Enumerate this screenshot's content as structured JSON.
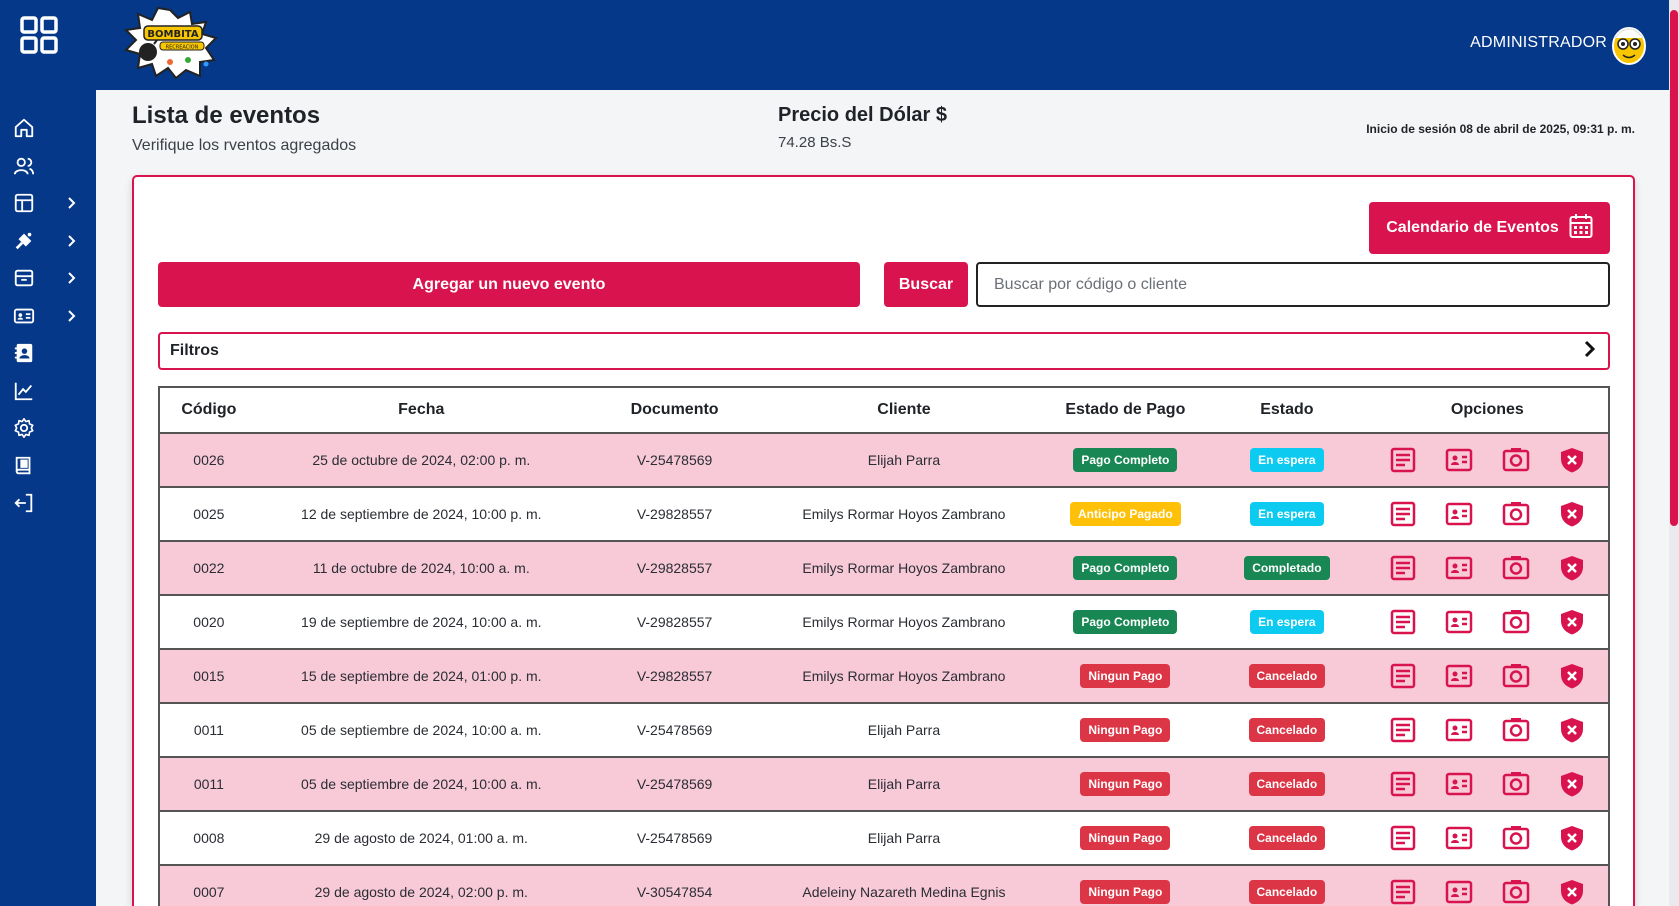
{
  "header": {
    "brand_text": "BOMBITA RECREACION",
    "admin_label": "ADMINISTRADOR"
  },
  "sidebar": {
    "items": [
      {
        "name": "home-icon",
        "chevron": false
      },
      {
        "name": "users-icon",
        "chevron": false
      },
      {
        "name": "layout-icon",
        "chevron": true
      },
      {
        "name": "palette-icon",
        "chevron": true
      },
      {
        "name": "archive-icon",
        "chevron": true
      },
      {
        "name": "id-card-icon",
        "chevron": true
      },
      {
        "name": "contact-icon",
        "chevron": false
      },
      {
        "name": "chart-icon",
        "chevron": false
      },
      {
        "name": "gear-icon",
        "chevron": false
      },
      {
        "name": "book-icon",
        "chevron": false
      },
      {
        "name": "logout-icon",
        "chevron": false
      }
    ]
  },
  "page": {
    "title": "Lista de eventos",
    "subtitle": "Verifique los rventos agregados",
    "dollar_title": "Precio del Dólar $",
    "dollar_value": "74.28 Bs.S",
    "session": "Inicio de sesión 08 de abril de 2025, 09:31 p. m."
  },
  "actions": {
    "calendar_label": "Calendario de Eventos",
    "add_label": "Agregar un nuevo evento",
    "search_label": "Buscar",
    "search_placeholder": "Buscar por código o cliente",
    "filters_label": "Filtros"
  },
  "table": {
    "headers": [
      "Código",
      "Fecha",
      "Documento",
      "Cliente",
      "Estado de Pago",
      "Estado",
      "Opciones"
    ],
    "rows": [
      {
        "code": "0026",
        "date": "25 de octubre de 2024, 02:00 p. m.",
        "doc": "V-25478569",
        "client": "Elijah Parra",
        "pay": "Pago Completo",
        "pay_color": "green",
        "status": "En espera",
        "status_color": "cyan"
      },
      {
        "code": "0025",
        "date": "12 de septiembre de 2024, 10:00 p. m.",
        "doc": "V-29828557",
        "client": "Emilys Rormar Hoyos Zambrano",
        "pay": "Anticipo Pagado",
        "pay_color": "yellow",
        "status": "En espera",
        "status_color": "cyan"
      },
      {
        "code": "0022",
        "date": "11 de octubre de 2024, 10:00 a. m.",
        "doc": "V-29828557",
        "client": "Emilys Rormar Hoyos Zambrano",
        "pay": "Pago Completo",
        "pay_color": "green",
        "status": "Completado",
        "status_color": "green"
      },
      {
        "code": "0020",
        "date": "19 de septiembre de 2024, 10:00 a. m.",
        "doc": "V-29828557",
        "client": "Emilys Rormar Hoyos Zambrano",
        "pay": "Pago Completo",
        "pay_color": "green",
        "status": "En espera",
        "status_color": "cyan"
      },
      {
        "code": "0015",
        "date": "15 de septiembre de 2024, 01:00 p. m.",
        "doc": "V-29828557",
        "client": "Emilys Rormar Hoyos Zambrano",
        "pay": "Ningun Pago",
        "pay_color": "red",
        "status": "Cancelado",
        "status_color": "red"
      },
      {
        "code": "0011",
        "date": "05 de septiembre de 2024, 10:00 a. m.",
        "doc": "V-25478569",
        "client": "Elijah Parra",
        "pay": "Ningun Pago",
        "pay_color": "red",
        "status": "Cancelado",
        "status_color": "red"
      },
      {
        "code": "0011",
        "date": "05 de septiembre de 2024, 10:00 a. m.",
        "doc": "V-25478569",
        "client": "Elijah Parra",
        "pay": "Ningun Pago",
        "pay_color": "red",
        "status": "Cancelado",
        "status_color": "red"
      },
      {
        "code": "0008",
        "date": "29 de agosto de 2024, 01:00 a. m.",
        "doc": "V-25478569",
        "client": "Elijah Parra",
        "pay": "Ningun Pago",
        "pay_color": "red",
        "status": "Cancelado",
        "status_color": "red"
      },
      {
        "code": "0007",
        "date": "29 de agosto de 2024, 02:00 p. m.",
        "doc": "V-30547854",
        "client": "Adeleiny Nazareth Medina Egnis",
        "pay": "Ningun Pago",
        "pay_color": "red",
        "status": "Cancelado",
        "status_color": "red"
      }
    ]
  },
  "colors": {
    "primary_blue": "#053888",
    "accent": "#d9134e",
    "row_pink": "#f8cad8"
  }
}
